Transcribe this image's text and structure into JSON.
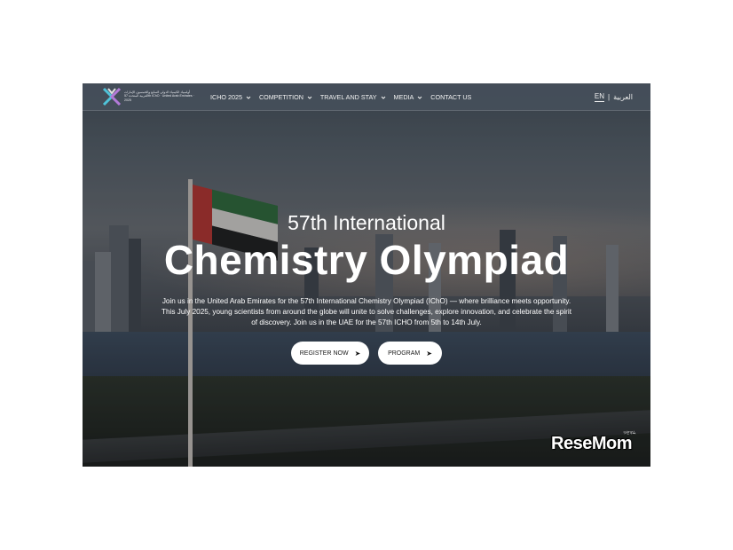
{
  "header": {
    "logo_text": "أولمبياد الكيمياء الدولي السابع والخمسون الإمارات العربية المتحدة 57th IChO · United Arab Emirates · 2025",
    "nav": [
      {
        "label": "ICHO 2025",
        "has_dropdown": true
      },
      {
        "label": "COMPETITION",
        "has_dropdown": true
      },
      {
        "label": "TRAVEL AND STAY",
        "has_dropdown": true
      },
      {
        "label": "MEDIA",
        "has_dropdown": true
      },
      {
        "label": "CONTACT US",
        "has_dropdown": false
      }
    ],
    "lang": {
      "en": "EN",
      "separator": "|",
      "ar": "العربية"
    }
  },
  "hero": {
    "subtitle": "57th International",
    "title": "Chemistry Olympiad",
    "description": "Join us in the United Arab Emirates for the 57th International Chemistry Olympiad (IChO) — where brilliance meets opportunity. This July 2025, young scientists from around the globe will unite to solve challenges, explore innovation, and celebrate the spirit of discovery. Join us in the UAE for the 57th ICHO from 5th to 14th July.",
    "buttons": {
      "register": "REGISTER NOW",
      "program": "PROGRAM",
      "arrow": "➤"
    }
  },
  "watermark": {
    "text": "ReseMom",
    "tag": "リセマム"
  },
  "colors": {
    "header_bg": "#46505c",
    "button_bg": "#ffffff",
    "text": "#ffffff"
  },
  "icons": [
    "chevron-down-icon",
    "arrow-right-icon",
    "logo-icon"
  ]
}
